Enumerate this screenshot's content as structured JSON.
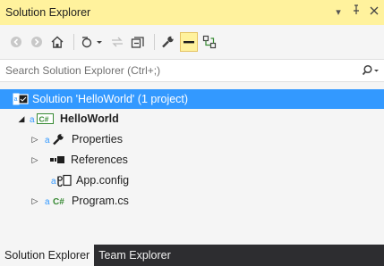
{
  "window": {
    "title": "Solution Explorer",
    "controls": {
      "dropdown": "▾",
      "pin": "⊥",
      "close": "✕"
    }
  },
  "toolbar": {
    "buttons": [
      {
        "icon": "back-arrow-icon"
      },
      {
        "icon": "forward-arrow-icon"
      },
      {
        "icon": "home-icon"
      },
      {
        "icon": "pending-changes-filter-icon"
      },
      {
        "icon": "sync-with-document-icon"
      },
      {
        "icon": "collapse-all-icon"
      },
      {
        "icon": "properties-wrench-icon"
      },
      {
        "icon": "preview-selected-items-icon"
      },
      {
        "icon": "view-class-diagram-icon"
      }
    ]
  },
  "search": {
    "placeholder": "Search Solution Explorer (Ctrl+;)",
    "value": ""
  },
  "tree": {
    "solution": "Solution 'HelloWorld' (1 project)",
    "project": "HelloWorld",
    "items": [
      {
        "label": "Properties",
        "icon": "wrench-icon"
      },
      {
        "label": "References",
        "icon": "references-icon"
      },
      {
        "label": "App.config",
        "icon": "config-file-icon"
      },
      {
        "label": "Program.cs",
        "icon": "csharp-file-icon"
      }
    ]
  },
  "tabs": [
    {
      "label": "Solution Explorer",
      "active": true
    },
    {
      "label": "Team Explorer",
      "active": false
    }
  ],
  "colors": {
    "title_bg": "#fff29d",
    "selection": "#3399ff",
    "tab_bar": "#2d2d30",
    "csharp_green": "#388a34"
  }
}
